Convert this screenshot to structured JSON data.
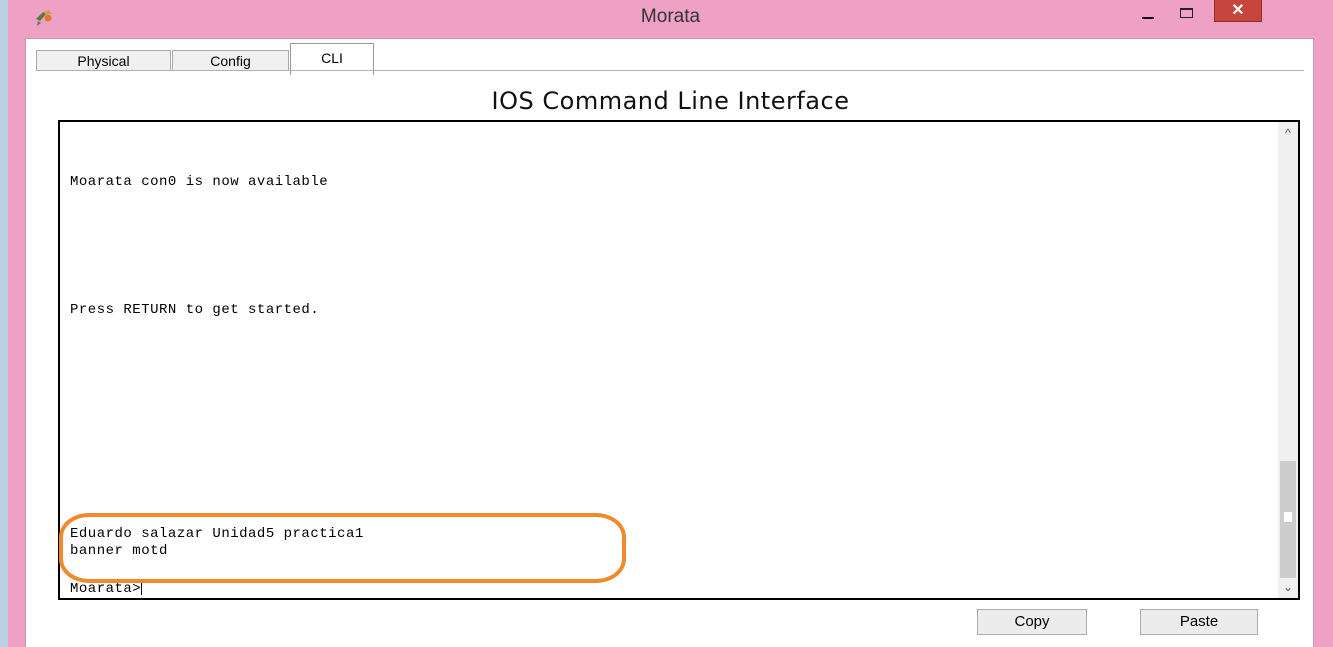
{
  "window": {
    "title": "Morata",
    "close_glyph": "✕",
    "icons": [
      "app-icon",
      "minimize-icon",
      "maximize-icon",
      "close-icon"
    ]
  },
  "tabs": [
    {
      "label": "Physical",
      "selected": false
    },
    {
      "label": "Config",
      "selected": false
    },
    {
      "label": "CLI",
      "selected": true
    }
  ],
  "cli": {
    "heading": "IOS Command Line Interface",
    "lines": {
      "available": "Moarata con0 is now available",
      "press_return": "Press RETURN to get started.",
      "banner_1": "Eduardo salazar Unidad5 practica1",
      "banner_2": "banner motd",
      "prompt": "Moarata>"
    },
    "highlight_color": "#f08a2c"
  },
  "scroll": {
    "up_glyph": "^",
    "down_glyph": "⌄"
  },
  "buttons": {
    "copy": "Copy",
    "paste": "Paste"
  },
  "colors": {
    "window_frame": "#eea0c5",
    "close_button": "#c7463c"
  }
}
